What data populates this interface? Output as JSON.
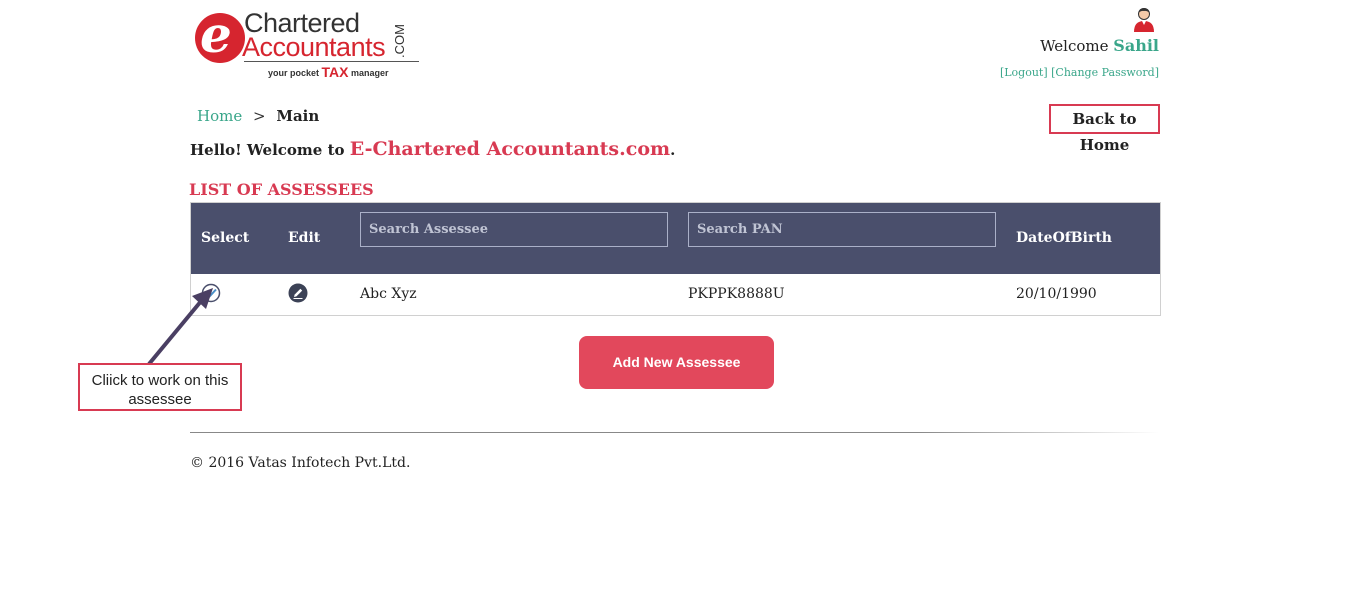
{
  "logo": {
    "letter": "e",
    "line1": "Chartered",
    "line2": "Accountants",
    "suffix": ".COM",
    "tagline_prefix": "your pocket",
    "tagline_tax": "TAX",
    "tagline_suffix": "manager"
  },
  "header": {
    "welcome_label": "Welcome",
    "username": "Sahil",
    "logout_link": "[Logout]",
    "change_password_link": "[Change Password]"
  },
  "breadcrumb": {
    "home": "Home",
    "separator": ">",
    "current": "Main"
  },
  "back_home_button": "Back to Home",
  "greeting": {
    "prefix": "Hello! Welcome to",
    "brand": "E-Chartered Accountants.com",
    "suffix": "."
  },
  "list_title": "LIST OF ASSESSEES",
  "table": {
    "headers": {
      "select": "Select",
      "edit": "Edit",
      "dob": "DateOfBirth"
    },
    "search_assessee_placeholder": "Search Assessee",
    "search_pan_placeholder": "Search PAN",
    "rows": [
      {
        "name": "Abc Xyz",
        "pan": "PKPPK8888U",
        "dob": "20/10/1990"
      }
    ]
  },
  "add_button": "Add New Assessee",
  "callout": {
    "line1": "Cliick to work on this",
    "line2": "assessee"
  },
  "footer": "© 2016 Vatas Infotech Pvt.Ltd.",
  "colors": {
    "accent_red": "#d83a52",
    "header_navy": "#4a4f6c",
    "link_green": "#3aa68a",
    "button_red": "#e2485c"
  }
}
